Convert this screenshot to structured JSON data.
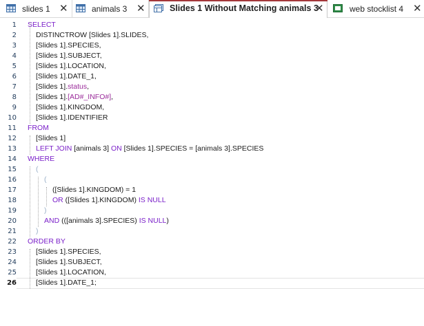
{
  "colors": {
    "accent": "#a4373a",
    "keyword": "#7a1fc9"
  },
  "tabs": [
    {
      "label": "slides 1",
      "icon": "table-icon",
      "active": false
    },
    {
      "label": "animals 3",
      "icon": "table-icon",
      "active": false
    },
    {
      "label": "Slides 1 Without Matching animals 3",
      "icon": "query-icon",
      "active": true
    },
    {
      "label": "web stocklist 4",
      "icon": "form-icon",
      "active": false
    }
  ],
  "close_glyph": "✕",
  "editor": {
    "current_line": 26,
    "lines": [
      {
        "n": "1",
        "indent": 0,
        "parts": [
          [
            "kw",
            "SELECT"
          ]
        ]
      },
      {
        "n": "2",
        "indent": 1,
        "parts": [
          [
            "",
            "DISTINCTROW [Slides 1].SLIDES,"
          ]
        ]
      },
      {
        "n": "3",
        "indent": 1,
        "parts": [
          [
            "",
            "[Slides 1].SPECIES,"
          ]
        ]
      },
      {
        "n": "4",
        "indent": 1,
        "parts": [
          [
            "",
            "[Slides 1].SUBJECT,"
          ]
        ]
      },
      {
        "n": "5",
        "indent": 1,
        "parts": [
          [
            "",
            "[Slides 1].LOCATION,"
          ]
        ]
      },
      {
        "n": "6",
        "indent": 1,
        "parts": [
          [
            "",
            "[Slides 1].DATE_1,"
          ]
        ]
      },
      {
        "n": "7",
        "indent": 1,
        "parts": [
          [
            "",
            "[Slides 1]."
          ],
          [
            "str",
            "status"
          ],
          [
            "",
            ","
          ]
        ]
      },
      {
        "n": "8",
        "indent": 1,
        "parts": [
          [
            "",
            "[Slides 1]."
          ],
          [
            "str",
            "[AD#_INFO#]"
          ],
          [
            "",
            ","
          ]
        ]
      },
      {
        "n": "9",
        "indent": 1,
        "parts": [
          [
            "",
            "[Slides 1].KINGDOM,"
          ]
        ]
      },
      {
        "n": "10",
        "indent": 1,
        "parts": [
          [
            "",
            "[Slides 1].IDENTIFIER"
          ]
        ]
      },
      {
        "n": "11",
        "indent": 0,
        "parts": [
          [
            "kw",
            "FROM"
          ]
        ]
      },
      {
        "n": "12",
        "indent": 1,
        "parts": [
          [
            "",
            "[Slides 1]"
          ]
        ]
      },
      {
        "n": "13",
        "indent": 1,
        "parts": [
          [
            "kw",
            "LEFT JOIN "
          ],
          [
            "",
            "[animals 3] "
          ],
          [
            "kw",
            "ON "
          ],
          [
            "",
            "[Slides 1].SPECIES = [animals 3].SPECIES"
          ]
        ]
      },
      {
        "n": "14",
        "indent": 0,
        "parts": [
          [
            "kw",
            "WHERE"
          ]
        ]
      },
      {
        "n": "15",
        "indent": 1,
        "parts": [
          [
            "br",
            "("
          ]
        ]
      },
      {
        "n": "16",
        "indent": 2,
        "parts": [
          [
            "br",
            "("
          ]
        ]
      },
      {
        "n": "17",
        "indent": 3,
        "parts": [
          [
            "",
            "([Slides 1].KINGDOM) = 1"
          ]
        ]
      },
      {
        "n": "18",
        "indent": 3,
        "parts": [
          [
            "kw",
            "OR "
          ],
          [
            "",
            "([Slides 1].KINGDOM) "
          ],
          [
            "kw",
            "IS NULL"
          ]
        ]
      },
      {
        "n": "19",
        "indent": 2,
        "parts": [
          [
            "br",
            ")"
          ]
        ]
      },
      {
        "n": "20",
        "indent": 2,
        "parts": [
          [
            "kw",
            "AND "
          ],
          [
            "",
            "(([animals 3].SPECIES) "
          ],
          [
            "kw",
            "IS NULL"
          ],
          [
            "",
            ")"
          ]
        ]
      },
      {
        "n": "21",
        "indent": 1,
        "parts": [
          [
            "br",
            ")"
          ]
        ]
      },
      {
        "n": "22",
        "indent": 0,
        "parts": [
          [
            "kw",
            "ORDER BY"
          ]
        ]
      },
      {
        "n": "23",
        "indent": 1,
        "parts": [
          [
            "",
            "[Slides 1].SPECIES,"
          ]
        ]
      },
      {
        "n": "24",
        "indent": 1,
        "parts": [
          [
            "",
            "[Slides 1].SUBJECT,"
          ]
        ]
      },
      {
        "n": "25",
        "indent": 1,
        "parts": [
          [
            "",
            "[Slides 1].LOCATION,"
          ]
        ]
      },
      {
        "n": "26",
        "indent": 1,
        "parts": [
          [
            "",
            "[Slides 1].DATE_1;"
          ]
        ]
      }
    ]
  }
}
